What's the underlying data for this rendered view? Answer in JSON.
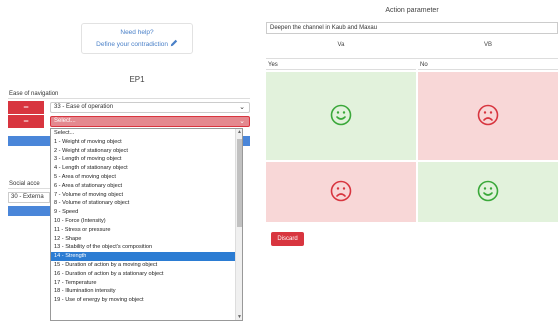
{
  "help": {
    "line1": "Need help?",
    "line2": "Define your contradiction"
  },
  "ep_title": "EP1",
  "sections": [
    {
      "label": "Ease of navigation"
    },
    {
      "label": "Social acce"
    }
  ],
  "rows": [
    {
      "selected": "33 - Ease of operation"
    },
    {
      "selected": "Select..."
    },
    {
      "selected": "30 - Externa"
    }
  ],
  "dropdown": {
    "items": [
      "Select...",
      "1 - Weight of moving object",
      "2 - Weight of stationary object",
      "3 - Length of moving object",
      "4 - Length of stationary object",
      "5 - Area of moving object",
      "6 - Area of stationary object",
      "7 - Volume of moving object",
      "8 - Volume of stationary object",
      "9 - Speed",
      "10 - Force (Intensity)",
      "11 - Stress or pressure",
      "12 - Shape",
      "13 - Stability of the object's composition",
      "14 - Strength",
      "15 - Duration of action by a moving object",
      "16 - Duration of action by a stationary object",
      "17 - Temperature",
      "18 - Illumination intensity",
      "19 - Use of energy by moving object"
    ],
    "selected_index": 14
  },
  "action": {
    "title": "Action parameter",
    "input_value": "Deepen the channel in Kaub and Maxau",
    "columns": [
      "Va",
      "VB"
    ],
    "rows": [
      "Yes",
      "No"
    ],
    "cells": [
      "happy",
      "sad",
      "sad",
      "happy"
    ]
  },
  "discard_label": "Discard",
  "colors": {
    "red": "#d8353f",
    "blue": "#4a86d9",
    "good_bg": "#e2f2dc",
    "bad_bg": "#f8d7d7",
    "good_icon": "#3aa83a",
    "bad_icon": "#d8353f"
  }
}
